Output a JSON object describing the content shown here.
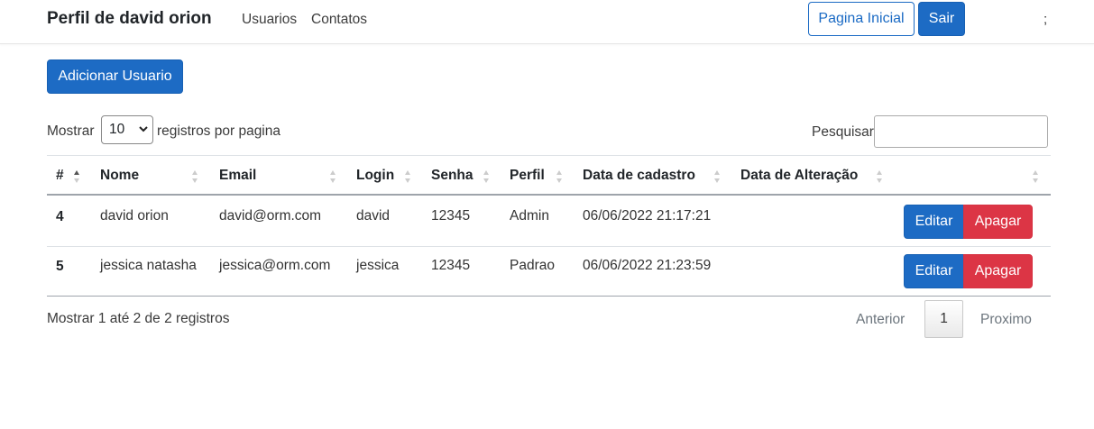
{
  "navbar": {
    "brand": "Perfil de david orion",
    "links": [
      "Usuarios",
      "Contatos"
    ],
    "home_button": "Pagina Inicial",
    "logout_button": "Sair",
    "extra": ";"
  },
  "add_user_button": "Adicionar Usuario",
  "length_control": {
    "prefix": "Mostrar",
    "selected": "10",
    "suffix": "registros por pagina"
  },
  "search": {
    "label": "Pesquisar",
    "value": ""
  },
  "table": {
    "columns": [
      "#",
      "Nome",
      "Email",
      "Login",
      "Senha",
      "Perfil",
      "Data de cadastro",
      "Data de Alteração",
      ""
    ],
    "rows": [
      {
        "id": "4",
        "nome": "david orion",
        "email": "david@orm.com",
        "login": "david",
        "senha": "12345",
        "perfil": "Admin",
        "data_cadastro": "06/06/2022 21:17:21",
        "data_alteracao": "",
        "edit": "Editar",
        "delete": "Apagar"
      },
      {
        "id": "5",
        "nome": "jessica natasha",
        "email": "jessica@orm.com",
        "login": "jessica",
        "senha": "12345",
        "perfil": "Padrao",
        "data_cadastro": "06/06/2022 21:23:59",
        "data_alteracao": "",
        "edit": "Editar",
        "delete": "Apagar"
      }
    ]
  },
  "info": "Mostrar 1 até 2 de 2 registros",
  "pagination": {
    "previous": "Anterior",
    "current_page": "1",
    "next": "Proximo"
  },
  "colors": {
    "primary": "#1d6bc4",
    "danger": "#dc3545"
  }
}
